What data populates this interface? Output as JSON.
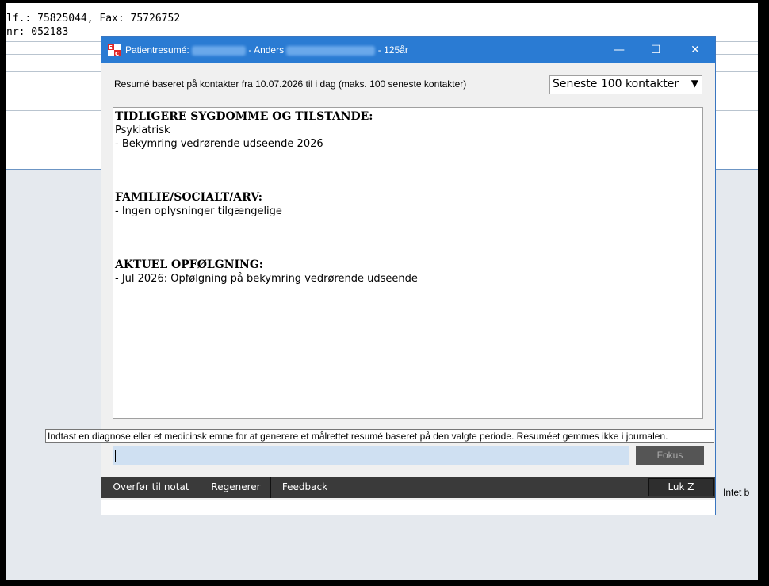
{
  "background": {
    "line1": "lf.: 75825044, Fax: 75726752",
    "line2": "nr: 052183",
    "right_text": "Intet b"
  },
  "dialog": {
    "title_prefix": "Patientresumé:",
    "title_name": "- Anders",
    "title_age": "- 125år",
    "minimize_label": "—",
    "maximize_label": "☐",
    "close_label": "✕",
    "period_label": "Resumé baseret på kontakter fra 10.07.2026 til i dag (maks. 100 seneste kontakter)",
    "period_select_value": "Seneste 100 kontakter",
    "summary": {
      "section1_title": "TIDLIGERE SYGDOMME OG TILSTANDE:",
      "section1_line1": "Psykiatrisk",
      "section1_line2": "- Bekymring vedrørende udseende 2026",
      "section2_title": "FAMILIE/SOCIALT/ARV:",
      "section2_line1": "- Ingen oplysninger tilgængelige",
      "section3_title": "AKTUEL OPFØLGNING:",
      "section3_line1": "- Jul 2026: Opfølgning på bekymring vedrørende udseende"
    },
    "tooltip": "Indtast en diagnose eller et medicinsk emne for at generere et målrettet resumé baseret på den valgte periode. Resuméet gemmes ikke i journalen.",
    "focus_button": "Fokus",
    "actions": {
      "transfer": "Overfør til notat",
      "regenerate": "Regenerer",
      "feedback": "Feedback",
      "close": "Luk Z"
    }
  },
  "colors": {
    "titlebar": "#2a7bd3",
    "actionbar": "#3a3a3a",
    "input_bg": "#cfe0f2"
  }
}
